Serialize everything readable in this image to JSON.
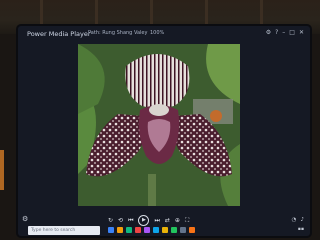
{
  "app": {
    "title": "Power Media Player"
  },
  "header": {
    "path": "Path: Rung Shang Valey",
    "zoom": "100%"
  },
  "window_controls": {
    "icons": [
      "gear-icon",
      "help-icon",
      "minimize-icon",
      "restore-icon",
      "close-icon"
    ]
  },
  "image": {
    "subject": "orchid"
  },
  "search": {
    "placeholder": "Type here to search"
  },
  "playback": {
    "icons": [
      "repeat-icon",
      "rotate-icon",
      "previous-icon",
      "play-icon",
      "next-icon",
      "shuffle-icon",
      "zoom-icon",
      "fullscreen-icon"
    ]
  },
  "colors": {
    "screen_bg": "#151924",
    "accent": "#cfd7e6",
    "orange_glow": "#f08a2a"
  }
}
